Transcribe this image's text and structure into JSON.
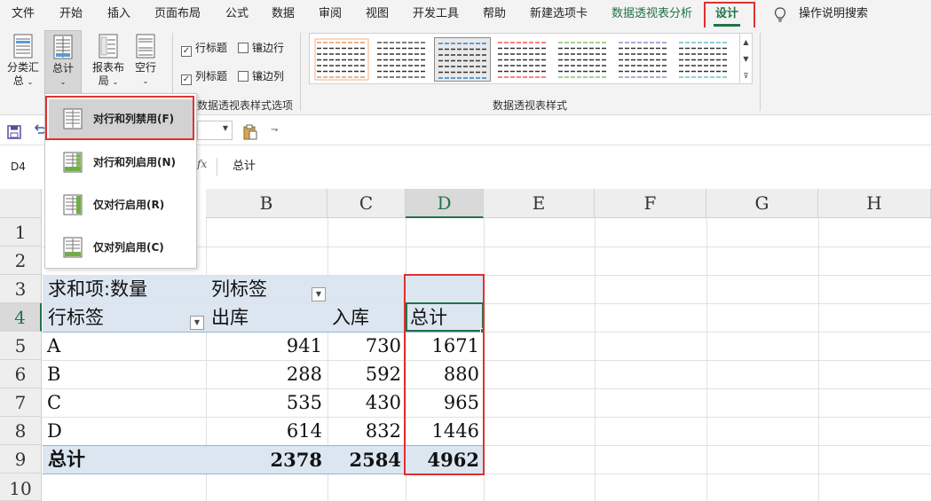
{
  "menu": {
    "tabs": [
      {
        "label": "文件"
      },
      {
        "label": "开始"
      },
      {
        "label": "插入"
      },
      {
        "label": "页面布局"
      },
      {
        "label": "公式"
      },
      {
        "label": "数据"
      },
      {
        "label": "审阅"
      },
      {
        "label": "视图"
      },
      {
        "label": "开发工具"
      },
      {
        "label": "帮助"
      },
      {
        "label": "新建选项卡"
      },
      {
        "label": "数据透视表分析"
      },
      {
        "label": "设计"
      }
    ],
    "active_tab": "设计",
    "search_label": "操作说明搜索"
  },
  "ribbon": {
    "subtotals": {
      "line1": "分类汇",
      "line2": "总"
    },
    "grand_totals": {
      "line1": "总计"
    },
    "report_layout": {
      "line1": "报表布",
      "line2": "局"
    },
    "blank_rows": {
      "line1": "空行"
    },
    "options": {
      "row_headers": {
        "label": "行标题",
        "checked": true
      },
      "column_headers": {
        "label": "列标题",
        "checked": true
      },
      "banded_rows": {
        "label": "镶边行",
        "checked": false
      },
      "banded_columns": {
        "label": "镶边列",
        "checked": false
      },
      "group_label": "数据透视表样式选项"
    },
    "styles_group_label": "数据透视表样式",
    "style_colors": [
      "#f4b183",
      "#7f7f7f",
      "#5b9bd5",
      "#ff7f7f",
      "#a9d18e",
      "#b4a7d6",
      "#8fd0d8"
    ]
  },
  "grand_totals_menu": {
    "items": [
      {
        "label": "对行和列禁用(F)"
      },
      {
        "label": "对行和列启用(N)"
      },
      {
        "label": "仅对行启用(R)"
      },
      {
        "label": "仅对列启用(C)"
      }
    ]
  },
  "formula_bar": {
    "name_box": "D4",
    "fx": "fx",
    "content": "总计"
  },
  "sheet": {
    "columns": [
      "B",
      "C",
      "D",
      "E",
      "F",
      "G",
      "H"
    ],
    "rows": [
      "1",
      "2",
      "3",
      "4",
      "5",
      "6",
      "7",
      "8",
      "9",
      "10"
    ],
    "pivot": {
      "values_label": "求和项:数量",
      "column_labels": "列标签",
      "row_labels": "行标签",
      "headers": [
        "出库",
        "入库",
        "总计"
      ],
      "data": [
        {
          "key": "A",
          "out": "941",
          "in": "730",
          "total": "1671"
        },
        {
          "key": "B",
          "out": "288",
          "in": "592",
          "total": "880"
        },
        {
          "key": "C",
          "out": "535",
          "in": "430",
          "total": "965"
        },
        {
          "key": "D",
          "out": "614",
          "in": "832",
          "total": "1446"
        }
      ],
      "grand_total": {
        "label": "总计",
        "out": "2378",
        "in": "2584",
        "total": "4962"
      }
    }
  }
}
